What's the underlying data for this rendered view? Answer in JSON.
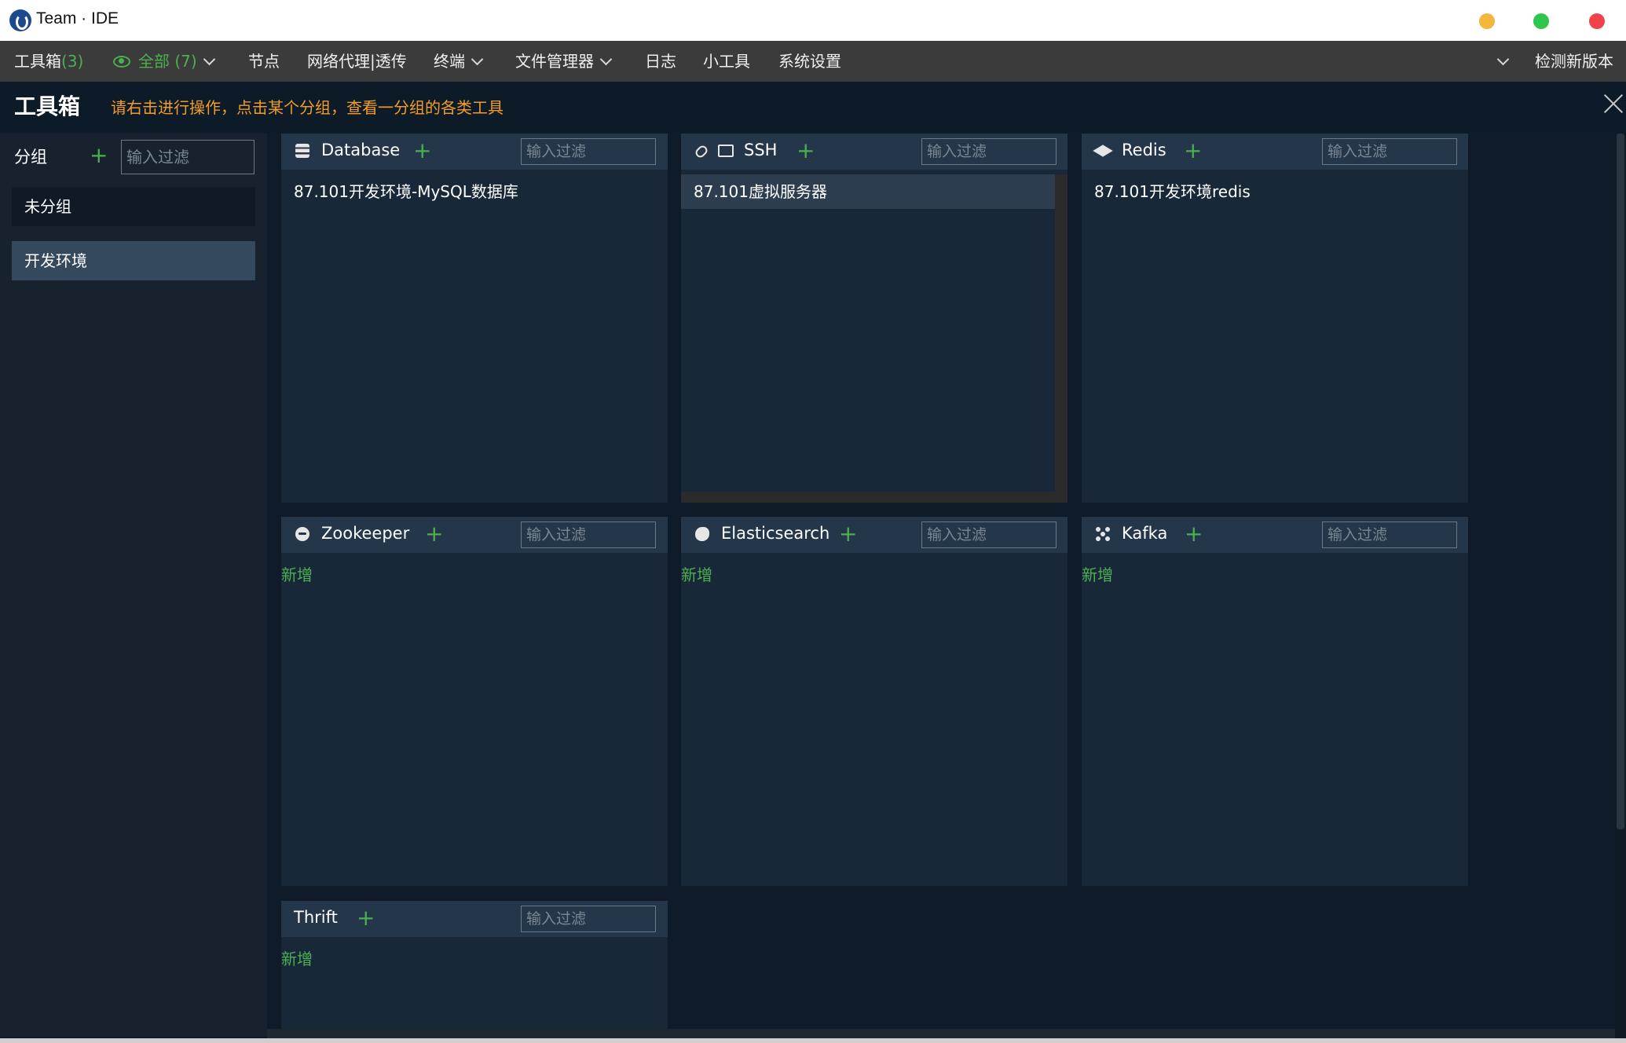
{
  "app": {
    "title": "Team · IDE"
  },
  "menu": {
    "toolbox_label": "工具箱",
    "toolbox_count": "(3)",
    "all_label": "全部 (7)",
    "items": [
      "节点",
      "网络代理|透传",
      "终端",
      "文件管理器",
      "日志",
      "小工具",
      "系统设置"
    ],
    "check_update": "检测新版本"
  },
  "header": {
    "title": "工具箱",
    "hint": "请右击进行操作，点击某个分组，查看一分组的各类工具"
  },
  "sidebar": {
    "label": "分组",
    "add": "+",
    "filter_placeholder": "输入过滤",
    "groups": [
      "未分组",
      "开发环境"
    ],
    "selected": "开发环境"
  },
  "panels": [
    {
      "title": "Database",
      "icon": "database-icon",
      "add": "+",
      "filter_placeholder": "输入过滤",
      "items": [
        "87.101开发环境-MySQL数据库"
      ],
      "new": ""
    },
    {
      "title": "SSH",
      "icon": "terminal-icon",
      "add": "+",
      "filter_placeholder": "输入过滤",
      "items": [
        "87.101虚拟服务器"
      ],
      "new": ""
    },
    {
      "title": "Redis",
      "icon": "redis-icon",
      "add": "+",
      "filter_placeholder": "输入过滤",
      "items": [
        "87.101开发环境redis"
      ],
      "new": ""
    },
    {
      "title": "Zookeeper",
      "icon": "zookeeper-icon",
      "add": "+",
      "filter_placeholder": "输入过滤",
      "items": [],
      "new": "新增"
    },
    {
      "title": "Elasticsearch",
      "icon": "elasticsearch-icon",
      "add": "+",
      "filter_placeholder": "输入过滤",
      "items": [],
      "new": "新增"
    },
    {
      "title": "Kafka",
      "icon": "kafka-icon",
      "add": "+",
      "filter_placeholder": "输入过滤",
      "items": [],
      "new": "新增"
    },
    {
      "title": "Thrift",
      "icon": "",
      "add": "+",
      "filter_placeholder": "输入过滤",
      "items": [],
      "new": "新增"
    }
  ],
  "colors": {
    "accent": "#4caf50",
    "hint": "#f39c28",
    "panel_bg": "#192838",
    "panel_header": "#243649"
  }
}
